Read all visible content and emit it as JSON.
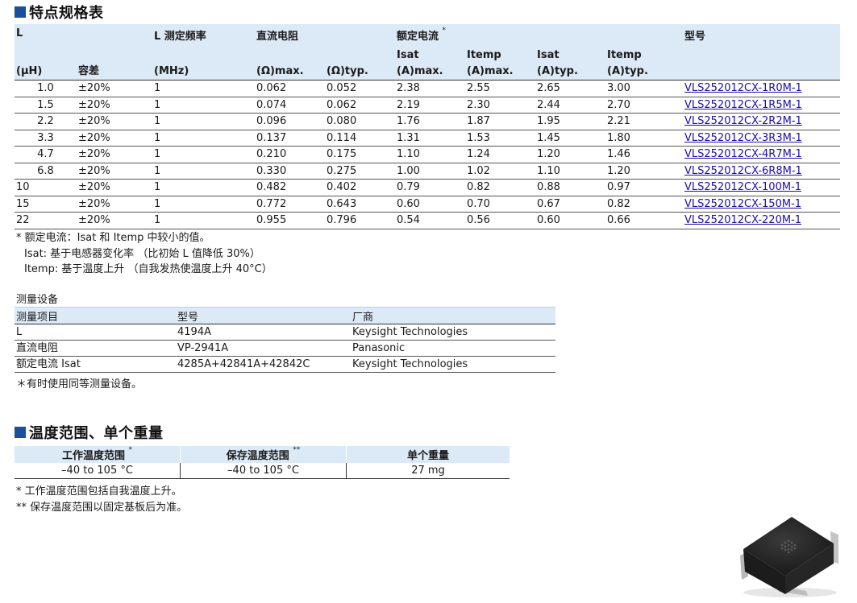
{
  "section1": {
    "title": "特点规格表"
  },
  "spec_table": {
    "headers": {
      "l_top": "L",
      "l_unit": "(μH)",
      "tolerance": "容差",
      "freq_top": "L 测定频率",
      "freq_unit": "(MHz)",
      "dcr_top": "直流电阻",
      "dcr_max": "(Ω)max.",
      "dcr_typ": "(Ω)typ.",
      "rated_top": "额定电流",
      "rated_mark": "*",
      "isat_max_top": "Isat",
      "isat_max_unit": "(A)max.",
      "itemp_max_top": "Itemp",
      "itemp_max_unit": "(A)max.",
      "isat_typ_top": "Isat",
      "isat_typ_unit": "(A)typ.",
      "itemp_typ_top": "Itemp",
      "itemp_typ_unit": "(A)typ.",
      "part_top": "型号"
    },
    "rows": [
      [
        "1.0",
        "±20%",
        "1",
        "0.062",
        "0.052",
        "2.38",
        "2.55",
        "2.65",
        "3.00",
        "VLS252012CX-1R0M-1"
      ],
      [
        "1.5",
        "±20%",
        "1",
        "0.074",
        "0.062",
        "2.19",
        "2.30",
        "2.44",
        "2.70",
        "VLS252012CX-1R5M-1"
      ],
      [
        "2.2",
        "±20%",
        "1",
        "0.096",
        "0.080",
        "1.76",
        "1.87",
        "1.95",
        "2.21",
        "VLS252012CX-2R2M-1"
      ],
      [
        "3.3",
        "±20%",
        "1",
        "0.137",
        "0.114",
        "1.31",
        "1.53",
        "1.45",
        "1.80",
        "VLS252012CX-3R3M-1"
      ],
      [
        "4.7",
        "±20%",
        "1",
        "0.210",
        "0.175",
        "1.10",
        "1.24",
        "1.20",
        "1.46",
        "VLS252012CX-4R7M-1"
      ],
      [
        "6.8",
        "±20%",
        "1",
        "0.330",
        "0.275",
        "1.00",
        "1.02",
        "1.10",
        "1.20",
        "VLS252012CX-6R8M-1"
      ],
      [
        "10",
        "±20%",
        "1",
        "0.482",
        "0.402",
        "0.79",
        "0.82",
        "0.88",
        "0.97",
        "VLS252012CX-100M-1"
      ],
      [
        "15",
        "±20%",
        "1",
        "0.772",
        "0.643",
        "0.60",
        "0.70",
        "0.67",
        "0.82",
        "VLS252012CX-150M-1"
      ],
      [
        "22",
        "±20%",
        "1",
        "0.955",
        "0.796",
        "0.54",
        "0.56",
        "0.60",
        "0.66",
        "VLS252012CX-220M-1"
      ]
    ]
  },
  "spec_notes": {
    "line1": "* 额定电流：Isat 和 Itemp 中较小的值。",
    "line2": "Isat: 基于电感器变化率 （比初始 L 值降低 30%）",
    "line3": "Itemp: 基于温度上升 （自我发热使温度上升 40°C）"
  },
  "measurement": {
    "title": "测量设备",
    "headers": [
      "测量项目",
      "型号",
      "厂商"
    ],
    "rows": [
      [
        "L",
        "4194A",
        "Keysight Technologies"
      ],
      [
        "直流电阻",
        "VP-2941A",
        "Panasonic"
      ],
      [
        "额定电流 Isat",
        "4285A+42841A+42842C",
        "Keysight Technologies"
      ]
    ],
    "note": "＊有时使用同等测量设备。"
  },
  "section2": {
    "title": "温度范围、单个重量"
  },
  "temp_table": {
    "headers": [
      "工作温度范围",
      "保存温度范围",
      "单个重量"
    ],
    "header_marks": [
      "*",
      "**",
      ""
    ],
    "values": [
      "–40 to 105 °C",
      "–40 to 105 °C",
      "27 mg"
    ]
  },
  "temp_notes": {
    "line1": "*  工作温度范围包括自我温度上升。",
    "line2": "** 保存温度范围以固定基板后为准。"
  },
  "colors": {
    "accent": "#1b4f9c",
    "header_bg": "#dce9f6",
    "link": "#1a0dab"
  },
  "image": {
    "icon": "inductor-component-image"
  }
}
